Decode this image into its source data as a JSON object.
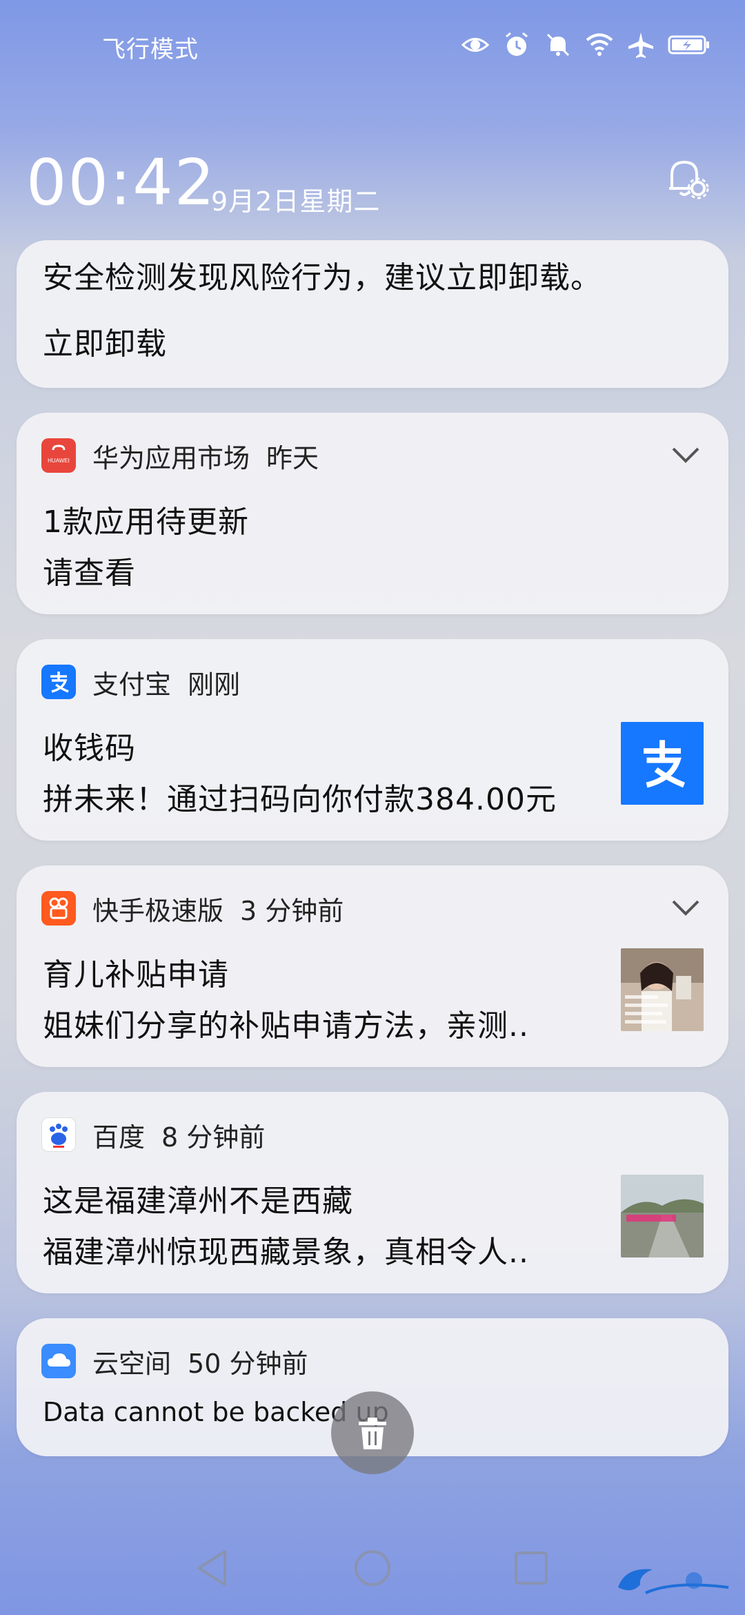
{
  "status_bar": {
    "mode_label": "飞行模式",
    "icons": [
      "eye-icon",
      "alarm-icon",
      "mute-icon",
      "wifi-icon",
      "airplane-icon",
      "battery-icon"
    ]
  },
  "header": {
    "time": "00:42",
    "date": "9月2日星期二",
    "settings_icon": "bell-settings-icon"
  },
  "notifications": [
    {
      "title": "安全检测发现风险行为，建议立即卸载。",
      "action": "立即卸载"
    },
    {
      "app": "华为应用市场",
      "time": "昨天",
      "title": "1款应用待更新",
      "body": "请查看",
      "icon_color": "#e8463c"
    },
    {
      "app": "支付宝",
      "time": "刚刚",
      "title": "收钱码",
      "body": "拼未来！通过扫码向你付款384.00元",
      "icon_color": "#1677ff"
    },
    {
      "app": "快手极速版",
      "time": "3 分钟前",
      "title": "育儿补贴申请",
      "body": "姐妹们分享的补贴申请方法，亲测..",
      "icon_color": "#ff5a1f"
    },
    {
      "app": "百度",
      "time": "8 分钟前",
      "title": "这是福建漳州不是西藏",
      "body": "福建漳州惊现西藏景象，真相令人..",
      "icon_color": "#2b63e6"
    },
    {
      "app": "云空间",
      "time": "50 分钟前",
      "title": "Data cannot be backed up",
      "icon_color": "#3a8cff"
    }
  ],
  "nav": {
    "back": "back-icon",
    "home": "home-icon",
    "recents": "recents-icon"
  }
}
